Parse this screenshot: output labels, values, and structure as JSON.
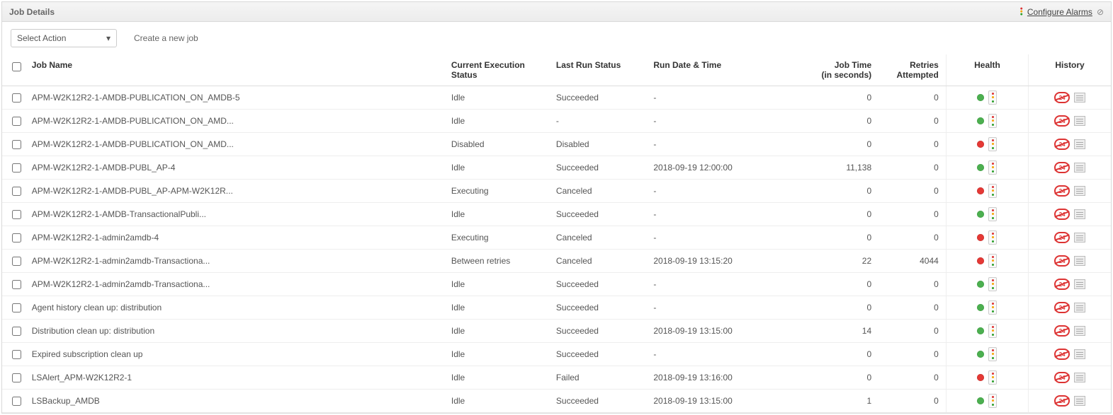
{
  "panel": {
    "title": "Job Details",
    "configure_alarms": "Configure Alarms"
  },
  "toolbar": {
    "select_action": "Select Action",
    "create_job": "Create a new job"
  },
  "columns": {
    "name": "Job Name",
    "exec_status_l1": "Current Execution",
    "exec_status_l2": "Status",
    "last_run": "Last Run Status",
    "run_date": "Run Date & Time",
    "job_time_l1": "Job Time",
    "job_time_l2": "(in seconds)",
    "retries_l1": "Retries",
    "retries_l2": "Attempted",
    "health": "Health",
    "history": "History"
  },
  "rows": [
    {
      "name": "APM-W2K12R2-1-AMDB-PUBLICATION_ON_AMDB-5",
      "exec": "Idle",
      "last": "Succeeded",
      "date": "-",
      "time": "0",
      "retries": "0",
      "health": "green"
    },
    {
      "name": "APM-W2K12R2-1-AMDB-PUBLICATION_ON_AMD...",
      "exec": "Idle",
      "last": "-",
      "date": "-",
      "time": "0",
      "retries": "0",
      "health": "green"
    },
    {
      "name": "APM-W2K12R2-1-AMDB-PUBLICATION_ON_AMD...",
      "exec": "Disabled",
      "last": "Disabled",
      "date": "-",
      "time": "0",
      "retries": "0",
      "health": "red"
    },
    {
      "name": "APM-W2K12R2-1-AMDB-PUBL_AP-4",
      "exec": "Idle",
      "last": "Succeeded",
      "date": "2018-09-19 12:00:00",
      "time": "11,138",
      "retries": "0",
      "health": "green"
    },
    {
      "name": "APM-W2K12R2-1-AMDB-PUBL_AP-APM-W2K12R...",
      "exec": "Executing",
      "last": "Canceled",
      "date": "-",
      "time": "0",
      "retries": "0",
      "health": "red"
    },
    {
      "name": "APM-W2K12R2-1-AMDB-TransactionalPubli...",
      "exec": "Idle",
      "last": "Succeeded",
      "date": "-",
      "time": "0",
      "retries": "0",
      "health": "green"
    },
    {
      "name": "APM-W2K12R2-1-admin2amdb-4",
      "exec": "Executing",
      "last": "Canceled",
      "date": "-",
      "time": "0",
      "retries": "0",
      "health": "red"
    },
    {
      "name": "APM-W2K12R2-1-admin2amdb-Transactiona...",
      "exec": "Between retries",
      "last": "Canceled",
      "date": "2018-09-19 13:15:20",
      "time": "22",
      "retries": "4044",
      "health": "red"
    },
    {
      "name": "APM-W2K12R2-1-admin2amdb-Transactiona...",
      "exec": "Idle",
      "last": "Succeeded",
      "date": "-",
      "time": "0",
      "retries": "0",
      "health": "green"
    },
    {
      "name": "Agent history clean up: distribution",
      "exec": "Idle",
      "last": "Succeeded",
      "date": "-",
      "time": "0",
      "retries": "0",
      "health": "green"
    },
    {
      "name": "Distribution clean up: distribution",
      "exec": "Idle",
      "last": "Succeeded",
      "date": "2018-09-19 13:15:00",
      "time": "14",
      "retries": "0",
      "health": "green"
    },
    {
      "name": "Expired subscription clean up",
      "exec": "Idle",
      "last": "Succeeded",
      "date": "-",
      "time": "0",
      "retries": "0",
      "health": "green"
    },
    {
      "name": "LSAlert_APM-W2K12R2-1",
      "exec": "Idle",
      "last": "Failed",
      "date": "2018-09-19 13:16:00",
      "time": "0",
      "retries": "0",
      "health": "red"
    },
    {
      "name": "LSBackup_AMDB",
      "exec": "Idle",
      "last": "Succeeded",
      "date": "2018-09-19 13:15:00",
      "time": "1",
      "retries": "0",
      "health": "green"
    }
  ]
}
